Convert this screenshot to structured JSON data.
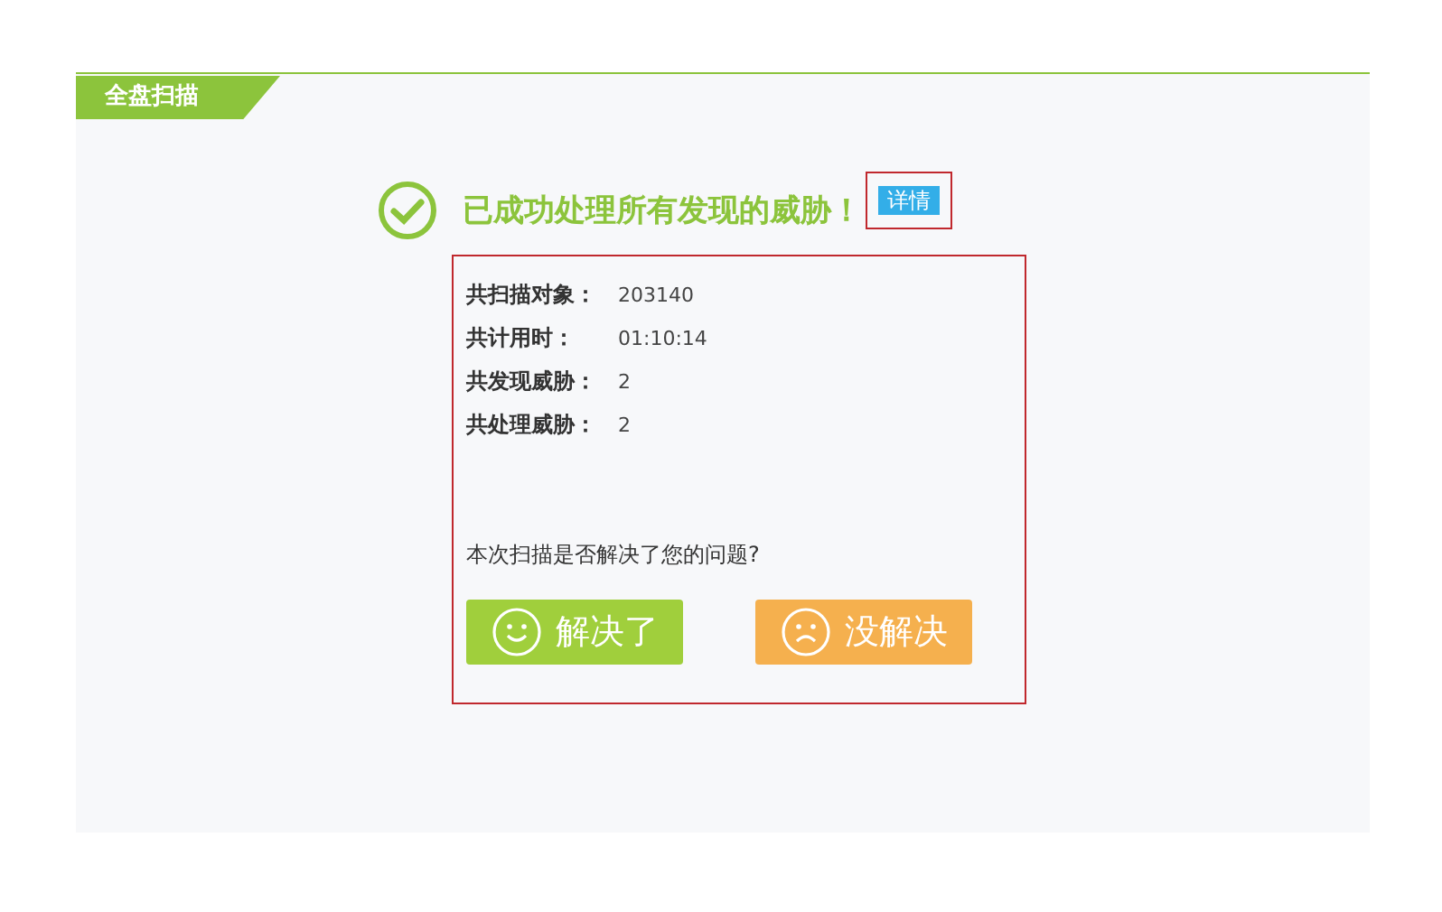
{
  "tab": {
    "label": "全盘扫描"
  },
  "result": {
    "title": "已成功处理所有发现的威胁！",
    "details_badge": "详情"
  },
  "stats": [
    {
      "label": "共扫描对象：",
      "value": "203140"
    },
    {
      "label": "共计用时：",
      "value": "01:10:14"
    },
    {
      "label": "共发现威胁：",
      "value": "2"
    },
    {
      "label": "共处理威胁：",
      "value": "2"
    }
  ],
  "question": "本次扫描是否解决了您的问题?",
  "buttons": [
    {
      "label": "解决了",
      "kind": "yes"
    },
    {
      "label": "没解决",
      "kind": "no"
    }
  ]
}
